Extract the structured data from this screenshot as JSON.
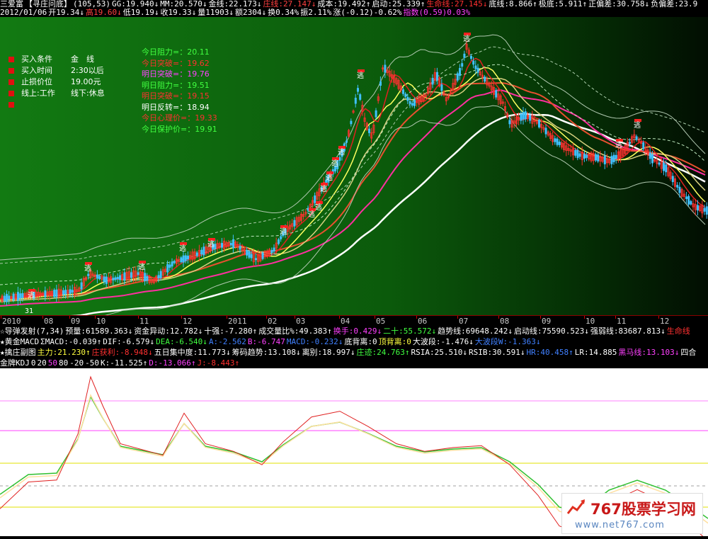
{
  "header": {
    "line1": [
      {
        "t": "三爱富",
        "c": "#ffffff"
      },
      {
        "t": "【寻庄问底】",
        "c": "#ffffff"
      },
      {
        "t": "(105,53)",
        "c": "#ffffff"
      },
      {
        "t": "GG:19.940↓",
        "c": "#ffffff"
      },
      {
        "t": "MM:20.570↓",
        "c": "#ffffff"
      },
      {
        "t": "金线:22.173↓",
        "c": "#ffffff"
      },
      {
        "t": "庄线:27.147↓",
        "c": "#ff4040"
      },
      {
        "t": "成本:19.492↑",
        "c": "#ffffff"
      },
      {
        "t": "启动:25.339↑",
        "c": "#ffffff"
      },
      {
        "t": "生命线:27.145↓",
        "c": "#ff3030"
      },
      {
        "t": "底线:8.866↑",
        "c": "#ffffff"
      },
      {
        "t": "极底:5.911↑",
        "c": "#ffffff"
      },
      {
        "t": "正偏差:30.758↓",
        "c": "#ffffff"
      },
      {
        "t": "负偏差:23.9",
        "c": "#ffffff"
      }
    ],
    "line2": [
      {
        "t": "2012/01/06",
        "c": "#ffffff"
      },
      {
        "t": "开19.34↓",
        "c": "#ffffff"
      },
      {
        "t": "高19.60↓",
        "c": "#ff4040"
      },
      {
        "t": "低19.19↓",
        "c": "#ffffff"
      },
      {
        "t": "收19.33↓",
        "c": "#ffffff"
      },
      {
        "t": "量11903↓",
        "c": "#ffffff"
      },
      {
        "t": "额2304↓",
        "c": "#ffffff"
      },
      {
        "t": "换0.34%",
        "c": "#ffffff"
      },
      {
        "t": "振2.11%",
        "c": "#ffffff"
      },
      {
        "t": "涨(-0.12)-0.62%",
        "c": "#ffffff"
      },
      {
        "t": "指数(0.59)0.03%",
        "c": "#ff40ff"
      }
    ]
  },
  "info_box": [
    {
      "k": "买入条件",
      "v": "金　线"
    },
    {
      "k": "买入时间",
      "v": "2:30以后"
    },
    {
      "k": "止损价位",
      "v": "19.00元"
    },
    {
      "k": "线上:工作",
      "v": "线下:休息"
    },
    {
      "k": "",
      "v": ""
    }
  ],
  "levels": [
    {
      "t": "今日阻力=：20.11",
      "c": "#40ff40"
    },
    {
      "t": "今日突破=：19.62",
      "c": "#ff3030"
    },
    {
      "t": "明日突破=：19.76",
      "c": "#ff40ff"
    },
    {
      "t": "明日阻力=：19.51",
      "c": "#40ff40"
    },
    {
      "t": "明日突破=：19.15",
      "c": "#ff3030"
    },
    {
      "t": "明日反转=：18.94",
      "c": "#ffffff"
    },
    {
      "t": "今日心理价=：19.33",
      "c": "#ff3030"
    },
    {
      "t": "今日保护价=：19.91",
      "c": "#40ff40"
    }
  ],
  "chart_labels": {
    "escape_tag": "逃",
    "low_mark": "31"
  },
  "months": [
    "2010",
    "08",
    "09",
    "10",
    "11",
    "12",
    "2011",
    "02",
    "03",
    "04",
    "05",
    "06",
    "07",
    "08",
    "09",
    "10",
    "11",
    "12"
  ],
  "indicators": {
    "line1": [
      {
        "t": "☆导弹发射(7,34)",
        "c": "#ffffff"
      },
      {
        "t": "预量:61589.363↓",
        "c": "#ffffff"
      },
      {
        "t": "资金异动:12.782↓",
        "c": "#ffffff"
      },
      {
        "t": "十强:-7.280↑",
        "c": "#ffffff"
      },
      {
        "t": "成交量比%:49.383↑",
        "c": "#ffffff"
      },
      {
        "t": "换手:0.429↓",
        "c": "#ff40ff"
      },
      {
        "t": "二十:55.572↓",
        "c": "#40ff40"
      },
      {
        "t": "趋势线:69648.242↓",
        "c": "#ffffff"
      },
      {
        "t": "启动线:75590.523↓",
        "c": "#ffffff"
      },
      {
        "t": "强弱线:83687.813↓",
        "c": "#ffffff"
      },
      {
        "t": "生命线",
        "c": "#ff3030"
      }
    ],
    "line2": [
      {
        "t": "★黄金MACD",
        "c": "#ffffff"
      },
      {
        "t": "ΣMACD:-0.039↑",
        "c": "#ffffff"
      },
      {
        "t": "DIF:-6.579↓",
        "c": "#ffffff"
      },
      {
        "t": "DEA:-6.540↓",
        "c": "#40ff40"
      },
      {
        "t": "A:-2.562",
        "c": "#4080ff"
      },
      {
        "t": "B:-6.747",
        "c": "#ff40ff"
      },
      {
        "t": "MACD:-0.232↓",
        "c": "#4080ff"
      },
      {
        "t": "底背离:0",
        "c": "#ffffff"
      },
      {
        "t": "顶背离:0",
        "c": "#ffff40"
      },
      {
        "t": "大波段:-1.476↓",
        "c": "#ffffff"
      },
      {
        "t": "大波段W:-1.363↓",
        "c": "#4080ff"
      }
    ],
    "line3": [
      {
        "t": "★擒庄副图",
        "c": "#ffffff"
      },
      {
        "t": "主力:21.230↑",
        "c": "#ffff40"
      },
      {
        "t": "庄获利:-8.948↓",
        "c": "#ff3030"
      },
      {
        "t": "五日集中度:11.773↓",
        "c": "#ffffff"
      },
      {
        "t": "筹码趋势:13.108↓",
        "c": "#ffffff"
      },
      {
        "t": "离别:18.997↓",
        "c": "#ffffff"
      },
      {
        "t": "庄迹:24.763↑",
        "c": "#40ff40"
      },
      {
        "t": "RSIA:25.510↓",
        "c": "#ffffff"
      },
      {
        "t": "RSIB:30.591↓",
        "c": "#ffffff"
      },
      {
        "t": "HR:40.458↑",
        "c": "#4080ff"
      },
      {
        "t": "LR:14.885",
        "c": "#ffffff"
      },
      {
        "t": "黑马线:13.103↓",
        "c": "#ff40ff"
      },
      {
        "t": "四合",
        "c": "#ffffff"
      }
    ],
    "line4": [
      {
        "t": "金牌KDJ",
        "c": "#ffffff"
      },
      {
        "t": "0",
        "c": "#ffffff"
      },
      {
        "t": "20",
        "c": "#ffffff"
      },
      {
        "t": "50",
        "c": "#ff40ff"
      },
      {
        "t": "80",
        "c": "#ffffff"
      },
      {
        "t": "-20",
        "c": "#ffffff"
      },
      {
        "t": "-50",
        "c": "#ffffff"
      },
      {
        "t": "K:-11.525↑",
        "c": "#ffffff"
      },
      {
        "t": "D:-13.066↑",
        "c": "#ff40ff"
      },
      {
        "t": "J:-8.443↑",
        "c": "#ff3030"
      }
    ]
  },
  "watermark": {
    "title": "767股票学习网",
    "url": "www.net767.com"
  },
  "colors": {
    "up": "#ff3030",
    "down": "#40c0ff",
    "panel_green": "#0f7a0f",
    "sub_bg": "#ffffff"
  }
}
